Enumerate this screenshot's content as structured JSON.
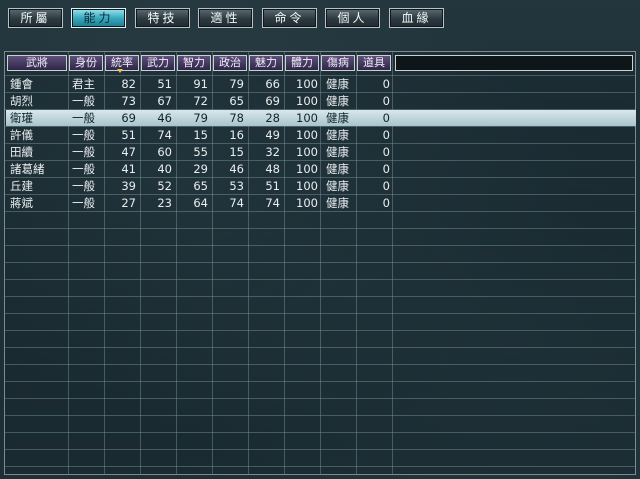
{
  "tabs": [
    {
      "label": "所屬",
      "active": false
    },
    {
      "label": "能力",
      "active": true
    },
    {
      "label": "特技",
      "active": false
    },
    {
      "label": "適性",
      "active": false
    },
    {
      "label": "命令",
      "active": false
    },
    {
      "label": "個人",
      "active": false
    },
    {
      "label": "血緣",
      "active": false
    }
  ],
  "columns": [
    "武將",
    "身份",
    "統率",
    "武力",
    "智力",
    "政治",
    "魅力",
    "體力",
    "傷病",
    "道具"
  ],
  "sorted_column": "統率",
  "selected_row": 2,
  "rows": [
    {
      "name": "鍾會",
      "rank": "君主",
      "lead": "82",
      "war": "51",
      "int": "91",
      "pol": "79",
      "chr": "66",
      "hp": "100",
      "status": "健康",
      "items": "0"
    },
    {
      "name": "胡烈",
      "rank": "一般",
      "lead": "73",
      "war": "67",
      "int": "72",
      "pol": "65",
      "chr": "69",
      "hp": "100",
      "status": "健康",
      "items": "0"
    },
    {
      "name": "衛瓘",
      "rank": "一般",
      "lead": "69",
      "war": "46",
      "int": "79",
      "pol": "78",
      "chr": "28",
      "hp": "100",
      "status": "健康",
      "items": "0"
    },
    {
      "name": "許儀",
      "rank": "一般",
      "lead": "51",
      "war": "74",
      "int": "15",
      "pol": "16",
      "chr": "49",
      "hp": "100",
      "status": "健康",
      "items": "0"
    },
    {
      "name": "田續",
      "rank": "一般",
      "lead": "47",
      "war": "60",
      "int": "55",
      "pol": "15",
      "chr": "32",
      "hp": "100",
      "status": "健康",
      "items": "0"
    },
    {
      "name": "諸葛緒",
      "rank": "一般",
      "lead": "41",
      "war": "40",
      "int": "29",
      "pol": "46",
      "chr": "48",
      "hp": "100",
      "status": "健康",
      "items": "0"
    },
    {
      "name": "丘建",
      "rank": "一般",
      "lead": "39",
      "war": "52",
      "int": "65",
      "pol": "53",
      "chr": "51",
      "hp": "100",
      "status": "健康",
      "items": "0"
    },
    {
      "name": "蔣斌",
      "rank": "一般",
      "lead": "27",
      "war": "23",
      "int": "64",
      "pol": "74",
      "chr": "74",
      "hp": "100",
      "status": "健康",
      "items": "0"
    }
  ]
}
